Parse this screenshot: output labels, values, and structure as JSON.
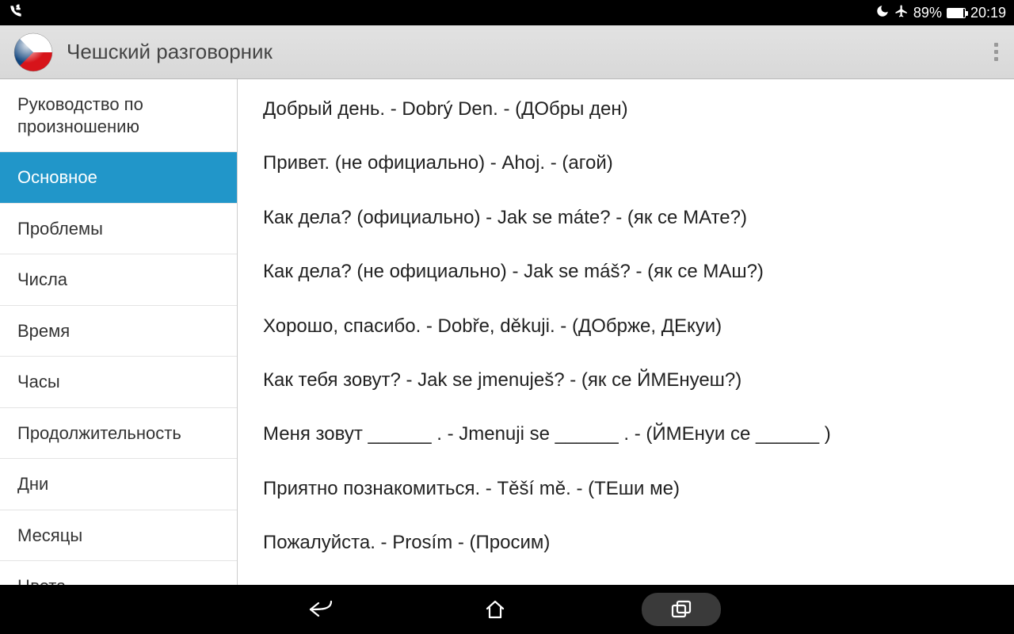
{
  "status": {
    "battery_percent": "89%",
    "time": "20:19"
  },
  "appbar": {
    "title": "Чешский разговорник"
  },
  "sidebar": {
    "items": [
      {
        "label": "Руководство по произношению",
        "active": false
      },
      {
        "label": "Основное",
        "active": true
      },
      {
        "label": "Проблемы",
        "active": false
      },
      {
        "label": "Числа",
        "active": false
      },
      {
        "label": "Время",
        "active": false
      },
      {
        "label": "Часы",
        "active": false
      },
      {
        "label": "Продолжительность",
        "active": false
      },
      {
        "label": "Дни",
        "active": false
      },
      {
        "label": "Месяцы",
        "active": false
      },
      {
        "label": "Цвета",
        "active": false
      }
    ]
  },
  "phrases": [
    "Добрый день. - Dobrý Den. - (ДОбры ден)",
    "Привет. (не официально) - Ahoj. - (агой)",
    "Как дела? (официально) - Jak se máte? - (як се МАте?)",
    "Как дела? (не официально) - Jak se máš? - (як се МАш?)",
    "Хорошо, спасибо. - Dobře, děkuji. - (ДОбрже, ДЕкуи)",
    "Как тебя зовут? - Jak se jmenuješ? - (як се ЙМЕнуеш?)",
    "Меня зовут ______ . - Jmenuji se ______ . - (ЙМЕнуи се ______ )",
    "Приятно познакомиться. - Těší mě. - (ТЕши ме)",
    "Пожалуйста. - Prosím - (Просим)"
  ]
}
